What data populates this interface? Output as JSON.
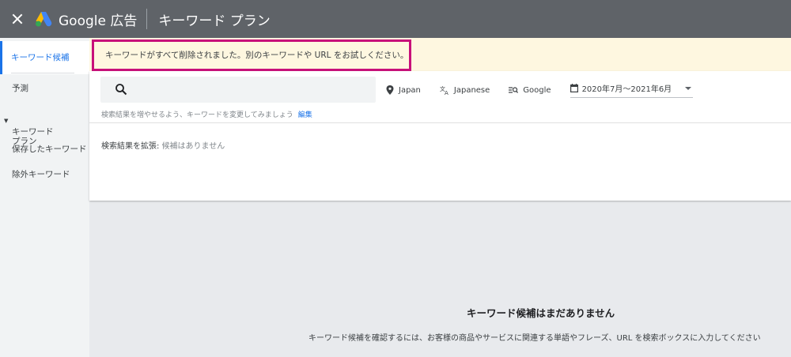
{
  "header": {
    "brand": "Google 広告",
    "page_title": "キーワード プラン"
  },
  "sidebar": {
    "items": [
      {
        "label": "キーワード候補"
      },
      {
        "label": "予測"
      },
      {
        "label": "キーワード\nプラン"
      },
      {
        "label": "保存したキーワード"
      },
      {
        "label": "除外キーワード"
      }
    ]
  },
  "banner": {
    "message": "キーワードがすべて削除されました。別のキーワードや URL をお試しください。"
  },
  "search": {
    "placeholder": ""
  },
  "filters": {
    "location": "Japan",
    "language": "Japanese",
    "network": "Google",
    "date_range": "2020年7月～2021年6月"
  },
  "hint": {
    "text": "検索結果を増やせるよう、キーワードを変更してみましょう",
    "edit": "編集"
  },
  "expand": {
    "label": "検索結果を拡張:",
    "value": "候補はありません"
  },
  "empty_state": {
    "title": "キーワード候補はまだありません",
    "description": "キーワード候補を確認するには、お客様の商品やサービスに関連する単語やフレーズ、URL を検索ボックスに入力してください"
  },
  "colors": {
    "topbar": "#5f6368",
    "accent": "#1a73e8",
    "banner_bg": "#fef7e0",
    "highlight_border": "#c8107a"
  }
}
